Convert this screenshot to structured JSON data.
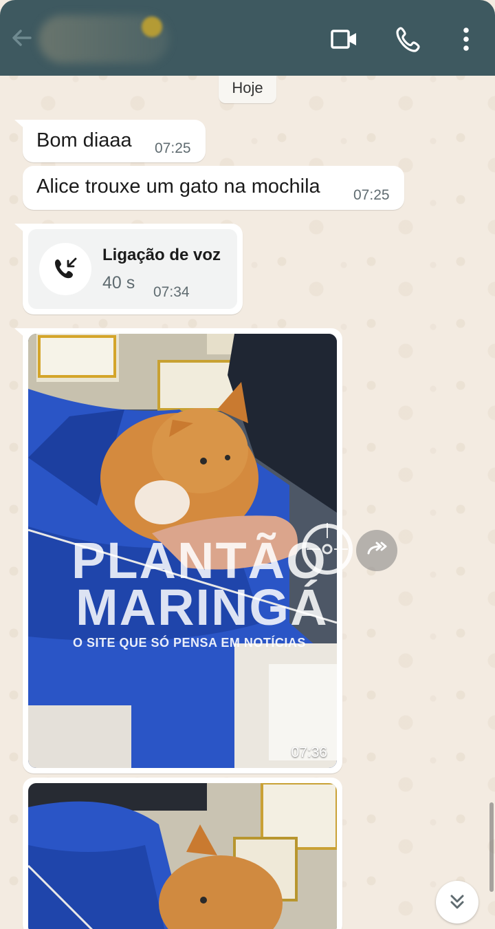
{
  "chat": {
    "date_label": "Hoje",
    "messages": [
      {
        "text": "Bom diaaa",
        "time": "07:25"
      },
      {
        "text": "Alice trouxe um gato na mochila",
        "time": "07:25"
      }
    ],
    "call": {
      "title": "Ligação de voz",
      "duration": "40 s",
      "time": "07:34"
    },
    "photos": [
      {
        "time": "07:36"
      }
    ]
  },
  "watermark": {
    "line1": "PLANTÃO",
    "line2": "MARINGÁ",
    "tagline": "O SITE QUE SÓ PENSA EM NOTÍCIAS"
  },
  "icons": {
    "back": "back-arrow-icon",
    "video": "video-call-icon",
    "call": "phone-call-icon",
    "menu": "more-vertical-icon",
    "incoming_call": "incoming-call-icon",
    "forward": "forward-icon",
    "scroll_down": "double-chevron-down-icon"
  },
  "colors": {
    "header": "#3e5960",
    "bubble": "#ffffff",
    "wallpaper": "#f3ebe1"
  }
}
